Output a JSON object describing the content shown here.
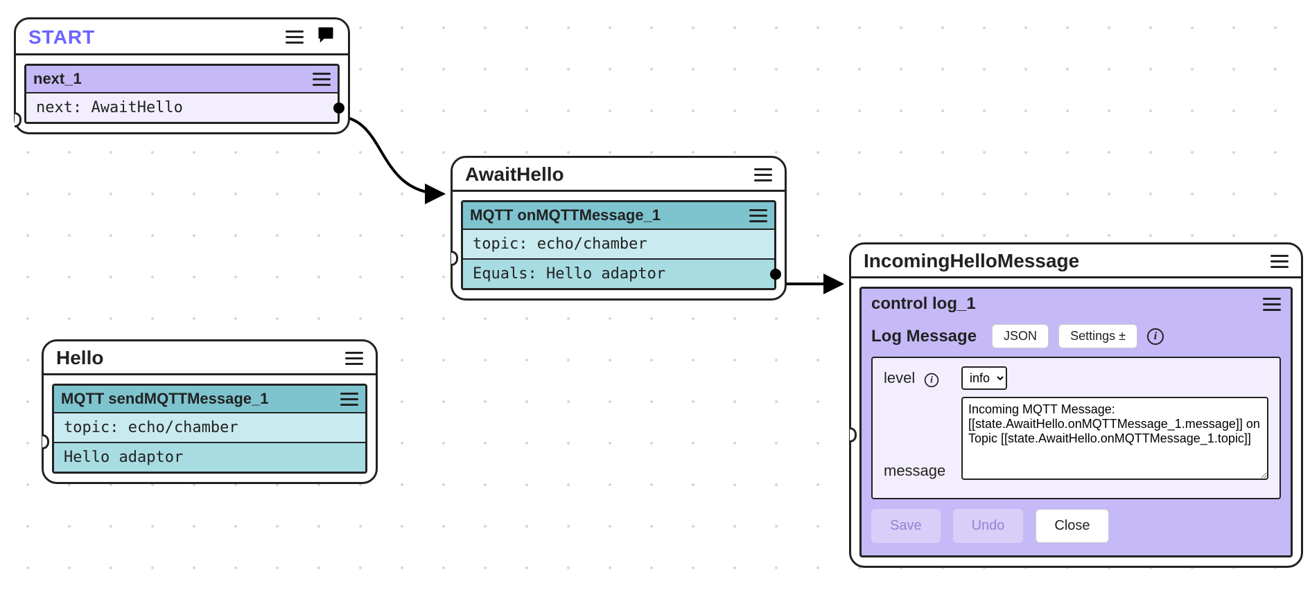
{
  "nodes": {
    "start": {
      "title": "START",
      "sub": {
        "title": "next_1",
        "rows": [
          "next: AwaitHello"
        ]
      }
    },
    "awaitHello": {
      "title": "AwaitHello",
      "sub": {
        "title": "MQTT onMQTTMessage_1",
        "rows": [
          "topic: echo/chamber",
          "Equals: Hello adaptor"
        ]
      }
    },
    "hello": {
      "title": "Hello",
      "sub": {
        "title": "MQTT sendMQTTMessage_1",
        "rows": [
          "topic: echo/chamber",
          "Hello adaptor"
        ]
      }
    },
    "incoming": {
      "title": "IncomingHelloMessage",
      "panel": {
        "title": "control log_1",
        "section_label": "Log Message",
        "btn_json": "JSON",
        "btn_settings": "Settings ±",
        "field_level_label": "level",
        "field_level_value": "info",
        "field_level_options": [
          "info"
        ],
        "field_message_label": "message",
        "field_message_value": "Incoming MQTT Message: [[state.AwaitHello.onMQTTMessage_1.message]] on Topic [[state.AwaitHello.onMQTTMessage_1.topic]]",
        "btn_save": "Save",
        "btn_undo": "Undo",
        "btn_close": "Close"
      }
    }
  },
  "chart_data": {
    "type": "diagram",
    "nodes": [
      {
        "id": "START",
        "kind": "start",
        "blocks": [
          {
            "name": "next_1",
            "rows": [
              "next: AwaitHello"
            ]
          }
        ]
      },
      {
        "id": "AwaitHello",
        "kind": "state",
        "blocks": [
          {
            "name": "MQTT onMQTTMessage_1",
            "rows": [
              "topic: echo/chamber",
              "Equals: Hello adaptor"
            ]
          }
        ]
      },
      {
        "id": "Hello",
        "kind": "state",
        "blocks": [
          {
            "name": "MQTT sendMQTTMessage_1",
            "rows": [
              "topic: echo/chamber",
              "Hello adaptor"
            ]
          }
        ]
      },
      {
        "id": "IncomingHelloMessage",
        "kind": "state",
        "blocks": [
          {
            "name": "control log_1",
            "editor": {
              "section": "Log Message",
              "level": "info",
              "message": "Incoming MQTT Message: [[state.AwaitHello.onMQTTMessage_1.message]] on Topic [[state.AwaitHello.onMQTTMessage_1.topic]]"
            }
          }
        ]
      }
    ],
    "edges": [
      {
        "from": "START.next_1",
        "to": "AwaitHello"
      },
      {
        "from": "AwaitHello.onMQTTMessage_1",
        "to": "IncomingHelloMessage"
      }
    ]
  }
}
